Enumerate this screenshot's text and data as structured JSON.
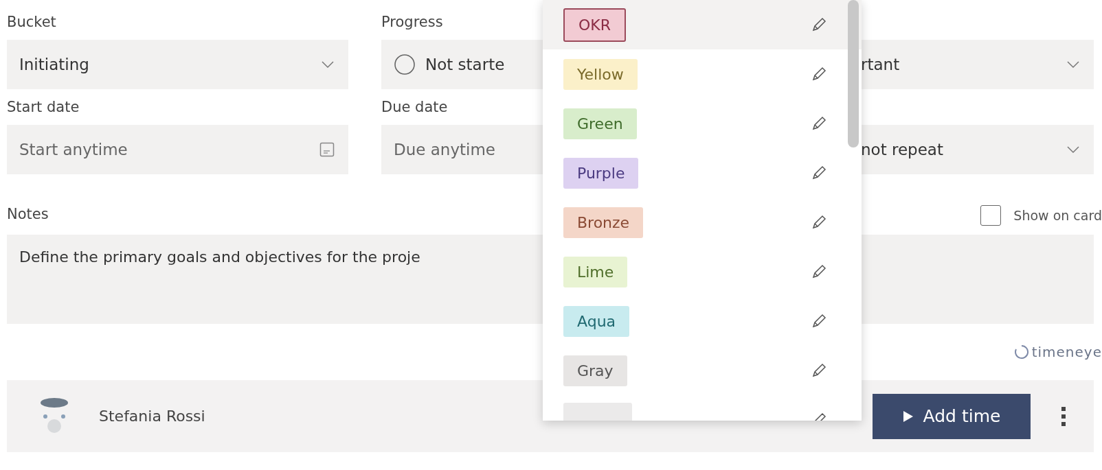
{
  "fields": [
    {
      "label": "Bucket",
      "value": "Initiating",
      "kind": "dropdown"
    },
    {
      "label": "Progress",
      "value": "Not starte",
      "kind": "progress"
    },
    {
      "value": "rtant",
      "kind": "dropdown"
    },
    {
      "label": "Start date",
      "placeholder": "Start anytime",
      "kind": "date"
    },
    {
      "label": "Due date",
      "placeholder": "Due anytime",
      "kind": "date-hidden"
    },
    {
      "value": "not repeat",
      "kind": "dropdown"
    }
  ],
  "notes": {
    "label": "Notes",
    "show_on_card": {
      "label": "Show on card",
      "checked": false
    },
    "value": "Define the primary goals and objectives for the proje"
  },
  "brand": "timeneye",
  "footer": {
    "user": "Stefania Rossi",
    "button": "Add time"
  },
  "label_menu": {
    "items": [
      {
        "label": "OKR",
        "color": "#f2cbd3",
        "selected": true
      },
      {
        "label": "Yellow",
        "color": "#fbf0c9",
        "selected": false
      },
      {
        "label": "Green",
        "color": "#d8edcb",
        "selected": false
      },
      {
        "label": "Purple",
        "color": "#ddd1f1",
        "selected": false
      },
      {
        "label": "Bronze",
        "color": "#f4d6c8",
        "selected": false
      },
      {
        "label": "Lime",
        "color": "#e8f3d2",
        "selected": false
      },
      {
        "label": "Aqua",
        "color": "#c8ebef",
        "selected": false
      },
      {
        "label": "Gray",
        "color": "#e7e5e4",
        "selected": false
      },
      {
        "color": "#ebeaea",
        "selected": false
      }
    ]
  }
}
